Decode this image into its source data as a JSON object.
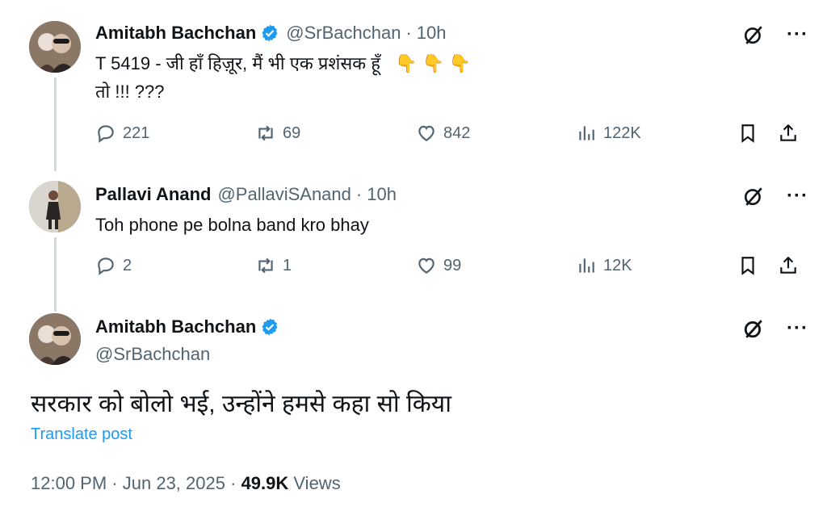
{
  "tweets": [
    {
      "name": "Amitabh Bachchan",
      "handle": "@SrBachchan",
      "time": "10h",
      "line1": "T 5419 - जी हाँ हिज़ूर, मैं भी एक प्रशंसक हूँ",
      "emoji": "👇👇👇",
      "line2": "तो !!! ???",
      "replies": "221",
      "reposts": "69",
      "likes": "842",
      "views": "122K"
    },
    {
      "name": "Pallavi Anand",
      "handle": "@PallaviSAnand",
      "time": "10h",
      "line1": "Toh phone pe bolna band kro bhay",
      "replies": "2",
      "reposts": "1",
      "likes": "99",
      "views": "12K"
    }
  ],
  "main": {
    "name": "Amitabh Bachchan",
    "handle": "@SrBachchan",
    "text": "सरकार को बोलो भई, उन्होंने हमसे कहा सो किया",
    "translate": "Translate post",
    "time": "12:00 PM",
    "date": "Jun 23, 2025",
    "views_count": "49.9K",
    "views_label": "Views"
  },
  "colors": {
    "accent": "#1d9bf0",
    "muted": "#536471",
    "text": "#0f1419",
    "line": "#cfd9de"
  },
  "icons": [
    "reply-icon",
    "repost-icon",
    "like-icon",
    "views-icon",
    "bookmark-icon",
    "share-icon",
    "grok-icon",
    "more-icon",
    "verified-icon"
  ]
}
